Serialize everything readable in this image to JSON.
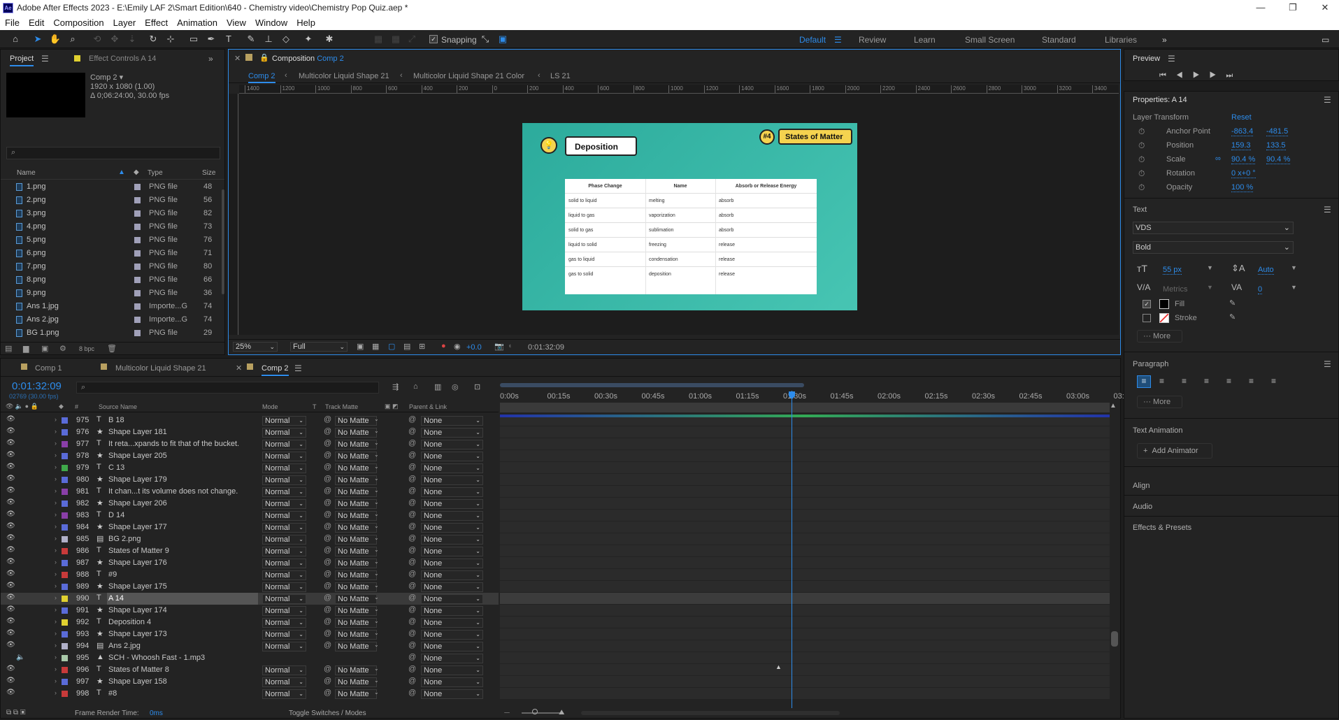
{
  "window": {
    "title": "Adobe After Effects 2023 - E:\\Emily LAF 2\\Smart Edition\\640 - Chemistry video\\Chemistry Pop Quiz.aep *",
    "logo": "Ae"
  },
  "menu": [
    "File",
    "Edit",
    "Composition",
    "Layer",
    "Effect",
    "Animation",
    "View",
    "Window",
    "Help"
  ],
  "toolbar": {
    "snapping": "Snapping",
    "workspaces": [
      "Default",
      "Review",
      "Learn",
      "Small Screen",
      "Standard",
      "Libraries"
    ],
    "active_workspace": "Default"
  },
  "project": {
    "tab": "Project",
    "tab2": "Effect Controls A 14",
    "comp_name": "Comp 2 ▾",
    "comp_res": "1920 x 1080 (1.00)",
    "comp_dur": "Δ 0;06:24:00, 30.00 fps",
    "columns": {
      "name": "Name",
      "type": "Type",
      "size": "Size"
    },
    "rows": [
      {
        "name": "1.png",
        "type": "PNG file",
        "size": "48"
      },
      {
        "name": "2.png",
        "type": "PNG file",
        "size": "56"
      },
      {
        "name": "3.png",
        "type": "PNG file",
        "size": "82"
      },
      {
        "name": "4.png",
        "type": "PNG file",
        "size": "73"
      },
      {
        "name": "5.png",
        "type": "PNG file",
        "size": "76"
      },
      {
        "name": "6.png",
        "type": "PNG file",
        "size": "71"
      },
      {
        "name": "7.png",
        "type": "PNG file",
        "size": "80"
      },
      {
        "name": "8.png",
        "type": "PNG file",
        "size": "66"
      },
      {
        "name": "9.png",
        "type": "PNG file",
        "size": "36"
      },
      {
        "name": "Ans 1.jpg",
        "type": "Importe...G",
        "size": "74"
      },
      {
        "name": "Ans 2.jpg",
        "type": "Importe...G",
        "size": "74"
      },
      {
        "name": "BG 1.png",
        "type": "PNG file",
        "size": "29"
      }
    ],
    "bpc": "8 bpc"
  },
  "comp": {
    "panel_title": "Composition",
    "panel_comp": "Comp 2",
    "breadcrumbs": [
      "Comp 2",
      "Multicolor Liquid Shape 21",
      "Multicolor Liquid Shape 21 Color",
      "LS 21"
    ],
    "ruler": [
      "1400",
      "1200",
      "1000",
      "800",
      "600",
      "400",
      "200",
      "0",
      "200",
      "400",
      "600",
      "800",
      "1000",
      "1200",
      "1400",
      "1600",
      "1800",
      "2000",
      "2200",
      "2400",
      "2600",
      "2800",
      "3000",
      "3200",
      "3400"
    ],
    "zoom": "25%",
    "quality": "Full",
    "exposure": "+0.0",
    "timecode": "0:01:32:09",
    "frame": {
      "title": "Deposition",
      "badge_num": "#4",
      "badge_text": "States of Matter",
      "table_head": [
        "Phase Change",
        "Name",
        "Absorb or Release Energy"
      ],
      "table_rows": [
        [
          "solid to liquid",
          "melting",
          "absorb"
        ],
        [
          "liquid to gas",
          "vaporization",
          "absorb"
        ],
        [
          "solid to gas",
          "sublimation",
          "absorb"
        ],
        [
          "liquid to solid",
          "freezing",
          "release"
        ],
        [
          "gas to liquid",
          "condensation",
          "release"
        ],
        [
          "gas to solid",
          "deposition",
          "release"
        ]
      ]
    }
  },
  "preview": {
    "title": "Preview"
  },
  "properties": {
    "title": "Properties: A 14",
    "layer_transform": "Layer Transform",
    "reset": "Reset",
    "items": [
      {
        "label": "Anchor Point",
        "v1": "-863.4",
        "v2": "-481.5"
      },
      {
        "label": "Position",
        "v1": "159.3",
        "v2": "133.5"
      },
      {
        "label": "Scale",
        "v1": "90.4 %",
        "v2": "90.4 %"
      },
      {
        "label": "Rotation",
        "v1": "0 x+0 °",
        "v2": ""
      },
      {
        "label": "Opacity",
        "v1": "100 %",
        "v2": ""
      }
    ],
    "text_section": "Text",
    "font": "VDS",
    "style": "Bold",
    "size": "55 px",
    "leading": "Auto",
    "kerning": "Metrics",
    "tracking": "0",
    "fill": "Fill",
    "stroke": "Stroke",
    "more": "More",
    "paragraph": "Paragraph",
    "text_animation": "Text Animation",
    "add_animator": "Add Animator",
    "align": "Align",
    "audio": "Audio",
    "effects": "Effects & Presets"
  },
  "timeline": {
    "tabs": [
      "Comp 1",
      "Multicolor Liquid Shape 21",
      "Comp 2"
    ],
    "timecode": "0:01:32:09",
    "frames": "02769 (30.00 fps)",
    "cols": {
      "num": "#",
      "source": "Source Name",
      "mode": "Mode",
      "t": "T",
      "matte": "Track Matte",
      "parent": "Parent & Link"
    },
    "ruler": [
      "0:00s",
      "00:15s",
      "00:30s",
      "00:45s",
      "01:00s",
      "01:15s",
      "01:30s",
      "01:45s",
      "02:00s",
      "02:15s",
      "02:30s",
      "02:45s",
      "03:00s",
      "03:"
    ],
    "layers": [
      {
        "num": "975",
        "type": "T",
        "name": "B 18",
        "color": "#5a6bd8",
        "mode": "Normal",
        "matte": "No Matte",
        "parent": "None"
      },
      {
        "num": "976",
        "type": "★",
        "name": "Shape Layer 181",
        "color": "#5a6bd8",
        "mode": "Normal",
        "matte": "No Matte",
        "parent": "None"
      },
      {
        "num": "977",
        "type": "T",
        "name": "It reta...xpands to fit that of the bucket.",
        "color": "#8a3fa8",
        "mode": "Normal",
        "matte": "No Matte",
        "parent": "None"
      },
      {
        "num": "978",
        "type": "★",
        "name": "Shape Layer 205",
        "color": "#5a6bd8",
        "mode": "Normal",
        "matte": "No Matte",
        "parent": "None"
      },
      {
        "num": "979",
        "type": "T",
        "name": "C 13",
        "color": "#3fa84a",
        "mode": "Normal",
        "matte": "No Matte",
        "parent": "None"
      },
      {
        "num": "980",
        "type": "★",
        "name": "Shape Layer 179",
        "color": "#5a6bd8",
        "mode": "Normal",
        "matte": "No Matte",
        "parent": "None"
      },
      {
        "num": "981",
        "type": "T",
        "name": "It chan...t its volume does not change.",
        "color": "#8a3fa8",
        "mode": "Normal",
        "matte": "No Matte",
        "parent": "None"
      },
      {
        "num": "982",
        "type": "★",
        "name": "Shape Layer 206",
        "color": "#5a6bd8",
        "mode": "Normal",
        "matte": "No Matte",
        "parent": "None"
      },
      {
        "num": "983",
        "type": "T",
        "name": "D 14",
        "color": "#8a3fa8",
        "mode": "Normal",
        "matte": "No Matte",
        "parent": "None"
      },
      {
        "num": "984",
        "type": "★",
        "name": "Shape Layer 177",
        "color": "#5a6bd8",
        "mode": "Normal",
        "matte": "No Matte",
        "parent": "None"
      },
      {
        "num": "985",
        "type": "img",
        "name": "BG 2.png",
        "color": "#b0b0c8",
        "mode": "Normal",
        "matte": "No Matte",
        "parent": "None"
      },
      {
        "num": "986",
        "type": "T",
        "name": "States of Matter 9",
        "color": "#c83a3a",
        "mode": "Normal",
        "matte": "No Matte",
        "parent": "None"
      },
      {
        "num": "987",
        "type": "★",
        "name": "Shape Layer 176",
        "color": "#5a6bd8",
        "mode": "Normal",
        "matte": "No Matte",
        "parent": "None"
      },
      {
        "num": "988",
        "type": "T",
        "name": "#9",
        "color": "#c83a3a",
        "mode": "Normal",
        "matte": "No Matte",
        "parent": "None"
      },
      {
        "num": "989",
        "type": "★",
        "name": "Shape Layer 175",
        "color": "#5a6bd8",
        "mode": "Normal",
        "matte": "No Matte",
        "parent": "None"
      },
      {
        "num": "990",
        "type": "T",
        "name": "A 14",
        "color": "#e0d030",
        "mode": "Normal",
        "matte": "No Matte",
        "parent": "None",
        "selected": true
      },
      {
        "num": "991",
        "type": "★",
        "name": "Shape Layer 174",
        "color": "#5a6bd8",
        "mode": "Normal",
        "matte": "No Matte",
        "parent": "None"
      },
      {
        "num": "992",
        "type": "T",
        "name": "Deposition 4",
        "color": "#e0d030",
        "mode": "Normal",
        "matte": "No Matte",
        "parent": "None"
      },
      {
        "num": "993",
        "type": "★",
        "name": "Shape Layer 173",
        "color": "#5a6bd8",
        "mode": "Normal",
        "matte": "No Matte",
        "parent": "None"
      },
      {
        "num": "994",
        "type": "img",
        "name": "Ans 2.jpg",
        "color": "#b0b0c8",
        "mode": "Normal",
        "matte": "No Matte",
        "parent": "None"
      },
      {
        "num": "995",
        "type": "audio",
        "name": "SCH - Whoosh Fast - 1.mp3",
        "color": "#a8c8a8",
        "mode": "",
        "matte": "",
        "parent": "None"
      },
      {
        "num": "996",
        "type": "T",
        "name": "States of Matter 8",
        "color": "#c83a3a",
        "mode": "Normal",
        "matte": "No Matte",
        "parent": "None"
      },
      {
        "num": "997",
        "type": "★",
        "name": "Shape Layer 158",
        "color": "#5a6bd8",
        "mode": "Normal",
        "matte": "No Matte",
        "parent": "None"
      },
      {
        "num": "998",
        "type": "T",
        "name": "#8",
        "color": "#c83a3a",
        "mode": "Normal",
        "matte": "No Matte",
        "parent": "None"
      }
    ],
    "footer": {
      "render_label": "Frame Render Time:",
      "render_value": "0ms",
      "toggle": "Toggle Switches / Modes"
    }
  }
}
